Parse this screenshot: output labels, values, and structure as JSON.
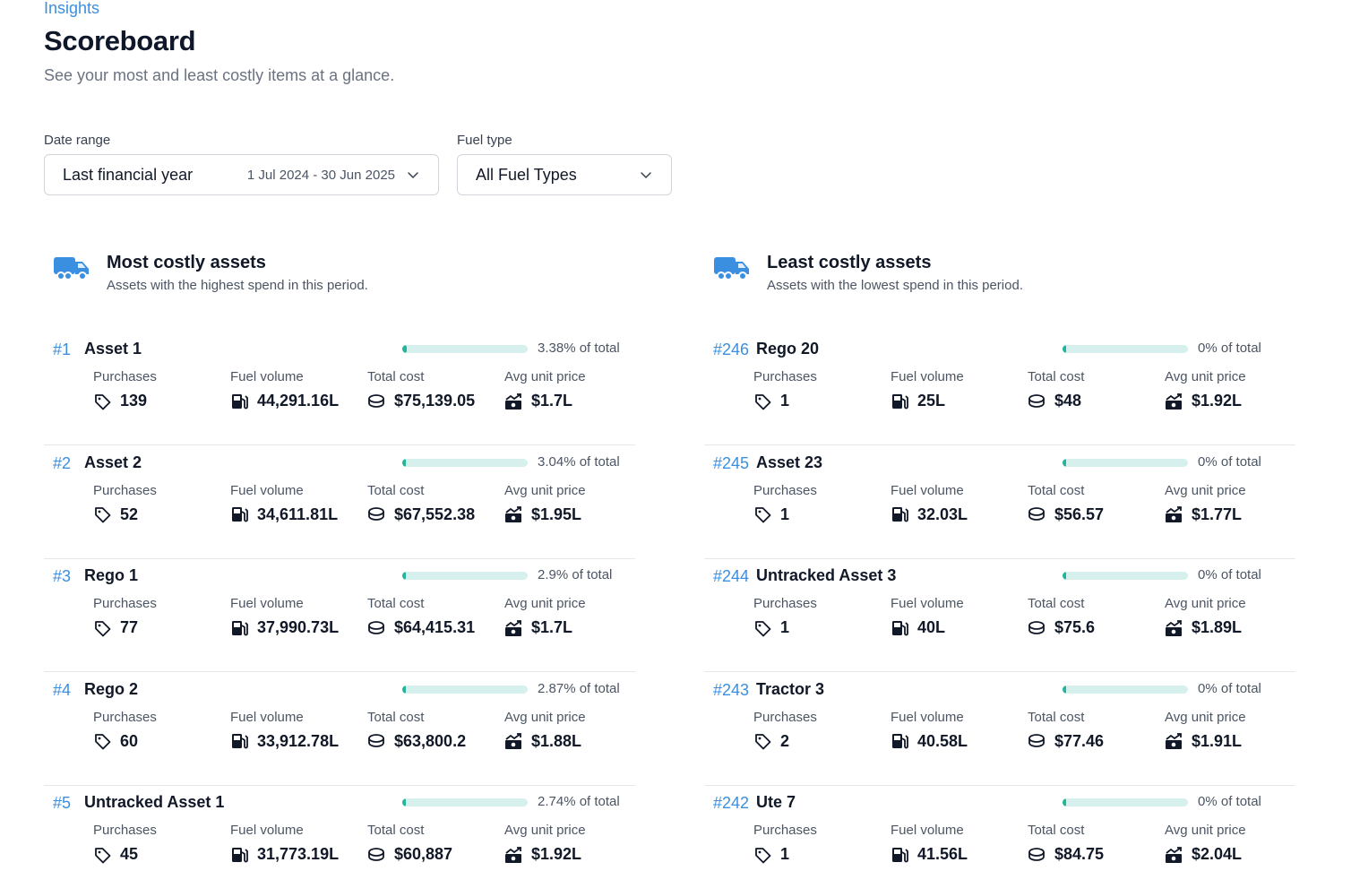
{
  "header": {
    "eyebrow": "Insights",
    "title": "Scoreboard",
    "subtitle": "See your most and least costly items at a glance."
  },
  "filters": {
    "date_range": {
      "label": "Date range",
      "value": "Last financial year",
      "range": "1 Jul 2024 - 30 Jun 2025"
    },
    "fuel_type": {
      "label": "Fuel type",
      "value": "All Fuel Types"
    }
  },
  "stat_labels": {
    "purchases": "Purchases",
    "fuel_volume": "Fuel volume",
    "total_cost": "Total cost",
    "avg_unit_price": "Avg unit price"
  },
  "colors": {
    "accent": "#3b8fe0",
    "bar_track": "#d6f0ee",
    "bar_fill": "#22b59b"
  },
  "most_costly": {
    "title": "Most costly assets",
    "subtitle": "Assets with the highest spend in this period.",
    "items": [
      {
        "rank": "#1",
        "name": "Asset 1",
        "share": 3.38,
        "pct": "3.38% of total",
        "purchases": "139",
        "fuel_volume": "44,291.16L",
        "total_cost": "$75,139.05",
        "avg_unit_price": "$1.7L"
      },
      {
        "rank": "#2",
        "name": "Asset 2",
        "share": 3.04,
        "pct": "3.04% of total",
        "purchases": "52",
        "fuel_volume": "34,611.81L",
        "total_cost": "$67,552.38",
        "avg_unit_price": "$1.95L"
      },
      {
        "rank": "#3",
        "name": "Rego 1",
        "share": 2.9,
        "pct": "2.9% of total",
        "purchases": "77",
        "fuel_volume": "37,990.73L",
        "total_cost": "$64,415.31",
        "avg_unit_price": "$1.7L"
      },
      {
        "rank": "#4",
        "name": "Rego 2",
        "share": 2.87,
        "pct": "2.87% of total",
        "purchases": "60",
        "fuel_volume": "33,912.78L",
        "total_cost": "$63,800.2",
        "avg_unit_price": "$1.88L"
      },
      {
        "rank": "#5",
        "name": "Untracked Asset 1",
        "share": 2.74,
        "pct": "2.74% of total",
        "purchases": "45",
        "fuel_volume": "31,773.19L",
        "total_cost": "$60,887",
        "avg_unit_price": "$1.92L"
      }
    ]
  },
  "least_costly": {
    "title": "Least costly assets",
    "subtitle": "Assets with the lowest spend in this period.",
    "items": [
      {
        "rank": "#246",
        "name": "Rego 20",
        "share": 0,
        "pct": "0% of total",
        "purchases": "1",
        "fuel_volume": "25L",
        "total_cost": "$48",
        "avg_unit_price": "$1.92L"
      },
      {
        "rank": "#245",
        "name": "Asset 23",
        "share": 0,
        "pct": "0% of total",
        "purchases": "1",
        "fuel_volume": "32.03L",
        "total_cost": "$56.57",
        "avg_unit_price": "$1.77L"
      },
      {
        "rank": "#244",
        "name": "Untracked Asset 3",
        "share": 0,
        "pct": "0% of total",
        "purchases": "1",
        "fuel_volume": "40L",
        "total_cost": "$75.6",
        "avg_unit_price": "$1.89L"
      },
      {
        "rank": "#243",
        "name": "Tractor 3",
        "share": 0,
        "pct": "0% of total",
        "purchases": "2",
        "fuel_volume": "40.58L",
        "total_cost": "$77.46",
        "avg_unit_price": "$1.91L"
      },
      {
        "rank": "#242",
        "name": "Ute 7",
        "share": 0,
        "pct": "0% of total",
        "purchases": "1",
        "fuel_volume": "41.56L",
        "total_cost": "$84.75",
        "avg_unit_price": "$2.04L"
      }
    ]
  }
}
